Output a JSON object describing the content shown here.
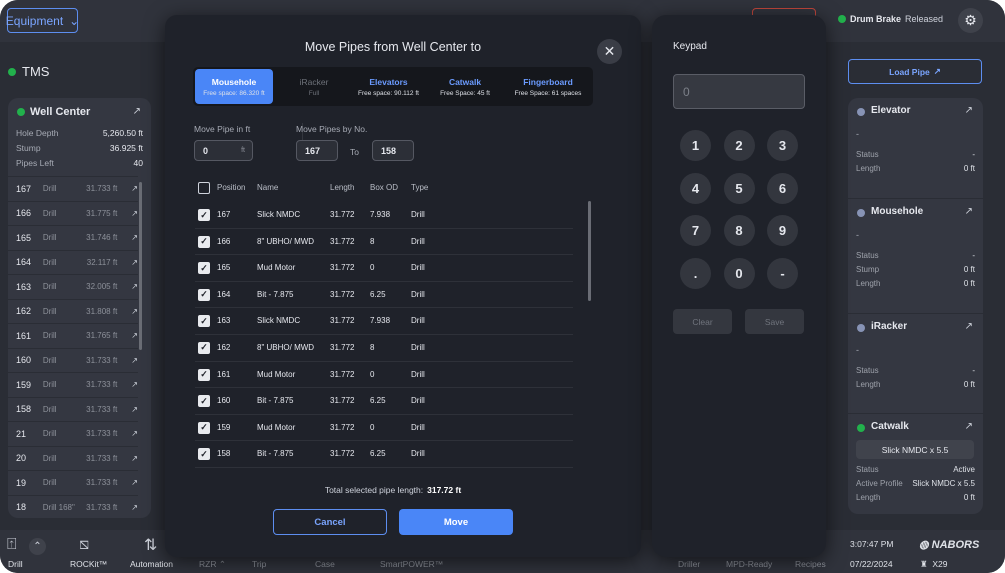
{
  "topbar": {
    "equipment": "Equipment",
    "drum_brake_label": "Drum Brake",
    "drum_brake_status": "Released"
  },
  "tms": {
    "title": "TMS"
  },
  "well_center": {
    "title": "Well Center",
    "hole_depth_label": "Hole Depth",
    "hole_depth": "5,260.50 ft",
    "stump_label": "Stump",
    "stump": "36.925 ft",
    "pipes_left_label": "Pipes Left",
    "pipes_left": "40",
    "pipes": [
      {
        "no": "167",
        "type": "Drill",
        "extra": "",
        "length": "31.733 ft"
      },
      {
        "no": "166",
        "type": "Drill",
        "extra": "",
        "length": "31.775 ft"
      },
      {
        "no": "165",
        "type": "Drill",
        "extra": "",
        "length": "31.746 ft"
      },
      {
        "no": "164",
        "type": "Drill",
        "extra": "",
        "length": "32.117 ft"
      },
      {
        "no": "163",
        "type": "Drill",
        "extra": "",
        "length": "32.005 ft"
      },
      {
        "no": "162",
        "type": "Drill",
        "extra": "",
        "length": "31.808 ft"
      },
      {
        "no": "161",
        "type": "Drill",
        "extra": "",
        "length": "31.765 ft"
      },
      {
        "no": "160",
        "type": "Drill",
        "extra": "",
        "length": "31.733 ft"
      },
      {
        "no": "159",
        "type": "Drill",
        "extra": "",
        "length": "31.733 ft"
      },
      {
        "no": "158",
        "type": "Drill",
        "extra": "",
        "length": "31.733 ft"
      },
      {
        "no": "21",
        "type": "Drill",
        "extra": "",
        "length": "31.733 ft"
      },
      {
        "no": "20",
        "type": "Drill",
        "extra": "",
        "length": "31.733 ft"
      },
      {
        "no": "19",
        "type": "Drill",
        "extra": "",
        "length": "31.733 ft"
      },
      {
        "no": "18",
        "type": "Drill",
        "extra": "168\"",
        "length": "31.733 ft"
      }
    ]
  },
  "modal": {
    "title": "Move Pipes from Well Center to",
    "destinations": [
      {
        "name": "Mousehole",
        "sub": "Free space: 86.320 ft",
        "state": "sel"
      },
      {
        "name": "iRacker",
        "sub": "Full",
        "state": "dis"
      },
      {
        "name": "Elevators",
        "sub": "Free space: 90.112 ft",
        "state": ""
      },
      {
        "name": "Catwalk",
        "sub": "Free Space: 45 ft",
        "state": ""
      },
      {
        "name": "Fingerboard",
        "sub": "Free Space: 61 spaces",
        "state": ""
      }
    ],
    "move_ft_label": "Move Pipe in ft",
    "move_ft_value": "0",
    "ft_unit": "ft",
    "move_no_label": "Move Pipes by No.",
    "from": "167",
    "to_label": "To",
    "to": "158",
    "columns": [
      "Position",
      "Name",
      "Length",
      "Box OD",
      "Type"
    ],
    "rows": [
      {
        "pos": "167",
        "name": "Slick NMDC",
        "length": "31.772",
        "od": "7.938",
        "type": "Drill"
      },
      {
        "pos": "166",
        "name": "8\" UBHO/ MWD",
        "length": "31.772",
        "od": "8",
        "type": "Drill"
      },
      {
        "pos": "165",
        "name": "Mud Motor",
        "length": "31.772",
        "od": "0",
        "type": "Drill"
      },
      {
        "pos": "164",
        "name": "Bit - 7.875",
        "length": "31.772",
        "od": "6.25",
        "type": "Drill"
      },
      {
        "pos": "163",
        "name": "Slick NMDC",
        "length": "31.772",
        "od": "7.938",
        "type": "Drill"
      },
      {
        "pos": "162",
        "name": "8\" UBHO/ MWD",
        "length": "31.772",
        "od": "8",
        "type": "Drill"
      },
      {
        "pos": "161",
        "name": "Mud Motor",
        "length": "31.772",
        "od": "0",
        "type": "Drill"
      },
      {
        "pos": "160",
        "name": "Bit - 7.875",
        "length": "31.772",
        "od": "6.25",
        "type": "Drill"
      },
      {
        "pos": "159",
        "name": "Mud Motor",
        "length": "31.772",
        "od": "0",
        "type": "Drill"
      },
      {
        "pos": "158",
        "name": "Bit - 7.875",
        "length": "31.772",
        "od": "6.25",
        "type": "Drill"
      }
    ],
    "total_label": "Total selected pipe length:",
    "total": "317.72 ft",
    "cancel": "Cancel",
    "move": "Move"
  },
  "keypad": {
    "title": "Keypad",
    "display": "0",
    "keys": [
      "1",
      "2",
      "3",
      "4",
      "5",
      "6",
      "7",
      "8",
      "9",
      ".",
      "0",
      "-"
    ],
    "clear": "Clear",
    "save": "Save"
  },
  "right": {
    "load_pipe": "Load Pipe",
    "elevator": {
      "title": "Elevator",
      "value": "-",
      "status_label": "Status",
      "status": "-",
      "length_label": "Length",
      "length": "0 ft"
    },
    "mousehole": {
      "title": "Mousehole",
      "value": "-",
      "status_label": "Status",
      "status": "-",
      "stump_label": "Stump",
      "stump": "0 ft",
      "length_label": "Length",
      "length": "0 ft"
    },
    "iracker": {
      "title": "iRacker",
      "value": "-",
      "status_label": "Status",
      "status": "-",
      "length_label": "Length",
      "length": "0 ft"
    },
    "catwalk": {
      "title": "Catwalk",
      "profile": "Slick NMDC x 5.5",
      "status_label": "Status",
      "status": "Active",
      "active_profile_label": "Active Profile",
      "active_profile": "Slick NMDC x 5.5",
      "length_label": "Length",
      "length": "0 ft"
    }
  },
  "bottom": {
    "drill": "Drill",
    "rockit": "ROCKit™",
    "automation": "Automation",
    "rzr": "RZR",
    "trip": "Trip",
    "case": "Case",
    "smartpower": "SmartPOWER™",
    "driller": "Driller",
    "mpd": "MPD-Ready",
    "recipes": "Recipes",
    "time": "3:07:47 PM",
    "date": "07/22/2024",
    "brand": "NABORS",
    "rig": "X29"
  }
}
